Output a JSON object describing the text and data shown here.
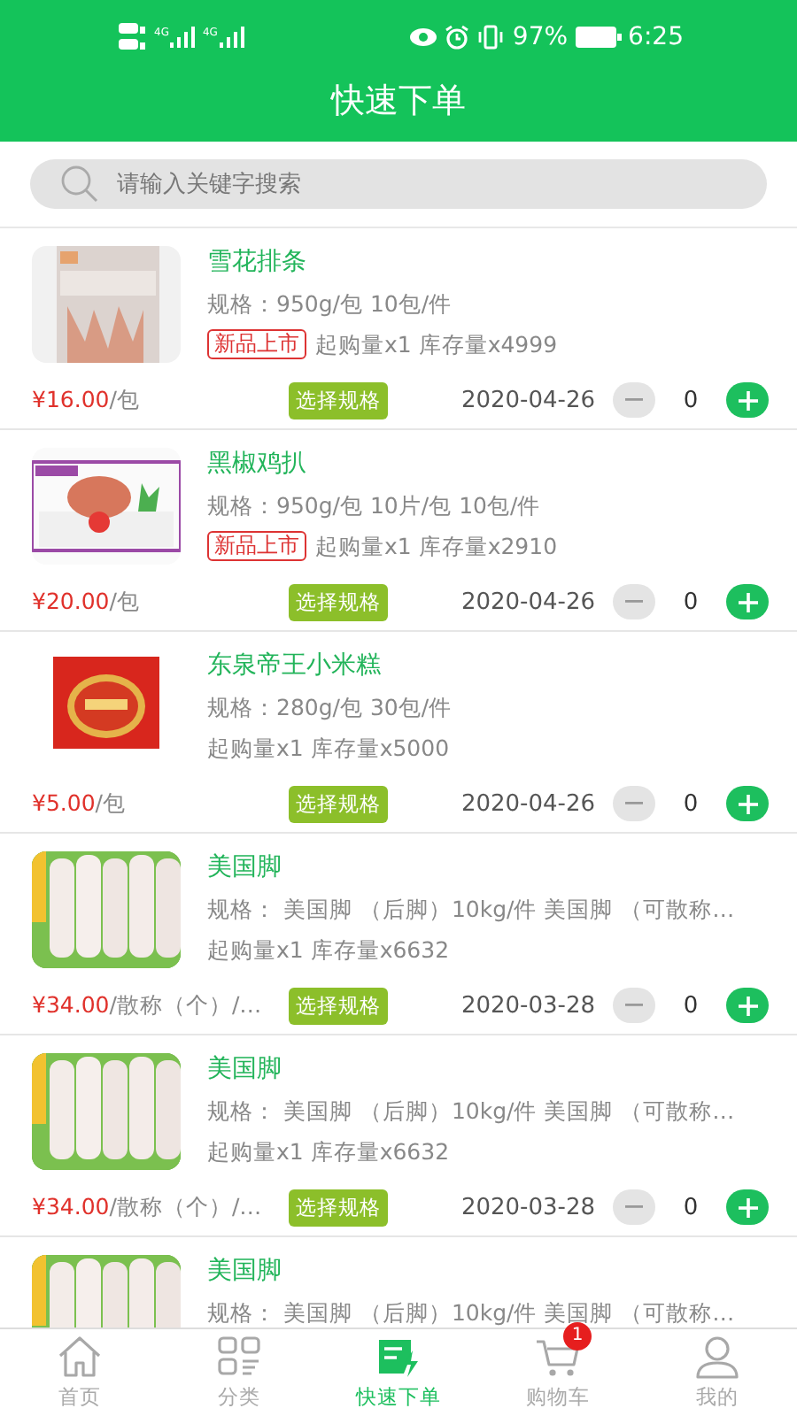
{
  "status_bar": {
    "network_1": "4G",
    "network_2": "4G",
    "battery": "97%",
    "time": "6:25"
  },
  "header": {
    "title": "快速下单"
  },
  "search": {
    "placeholder": "请输入关键字搜索"
  },
  "products": [
    {
      "name": "雪花排条",
      "spec": "规格：950g/包 10包/件",
      "tag": "新品上市",
      "stock": "起购量x1 库存量x4999",
      "price": "¥16.00",
      "unit": "/包",
      "button": "选择规格",
      "date": "2020-04-26",
      "quantity": "0"
    },
    {
      "name": "黑椒鸡扒",
      "spec": "规格：950g/包 10片/包 10包/件",
      "tag": "新品上市",
      "stock": "起购量x1 库存量x2910",
      "price": "¥20.00",
      "unit": "/包",
      "button": "选择规格",
      "date": "2020-04-26",
      "quantity": "0"
    },
    {
      "name": "东泉帝王小米糕",
      "spec": "规格：280g/包 30包/件",
      "stock": "起购量x1 库存量x5000",
      "price": "¥5.00",
      "unit": "/包",
      "button": "选择规格",
      "date": "2020-04-26",
      "quantity": "0"
    },
    {
      "name": "美国脚",
      "spec": "规格： 美国脚 （后脚）10kg/件 美国脚 （可散称…",
      "stock": "起购量x1 库存量x6632",
      "price": "¥34.00",
      "unit": "/散称（个）/…",
      "button": "选择规格",
      "date": "2020-03-28",
      "quantity": "0"
    },
    {
      "name": "美国脚",
      "spec": "规格： 美国脚 （后脚）10kg/件 美国脚 （可散称…",
      "stock": "起购量x1 库存量x6632",
      "price": "¥34.00",
      "unit": "/散称（个）/…",
      "button": "选择规格",
      "date": "2020-03-28",
      "quantity": "0"
    },
    {
      "name": "美国脚",
      "spec": "规格： 美国脚 （后脚）10kg/件 美国脚 （可散称…"
    }
  ],
  "tabs": [
    {
      "kind": "home",
      "label": "首页",
      "selected": false
    },
    {
      "kind": "category",
      "label": "分类",
      "selected": false
    },
    {
      "kind": "quick",
      "label": "快速下单",
      "selected": true
    },
    {
      "kind": "cart",
      "label": "购物车",
      "selected": false,
      "badge": "1"
    },
    {
      "kind": "profile",
      "label": "我的",
      "selected": false
    }
  ]
}
